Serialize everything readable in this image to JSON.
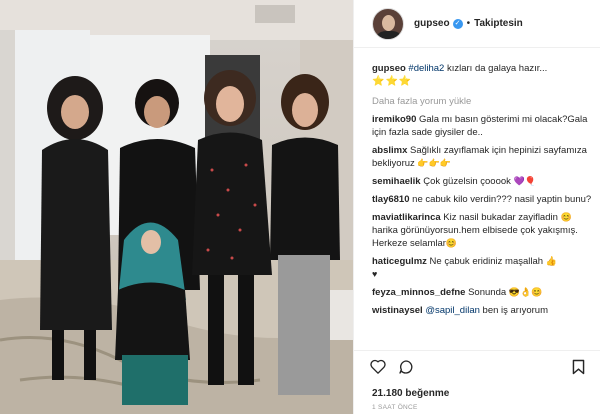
{
  "post": {
    "username": "gupseo",
    "verified_mark": "✓",
    "separator": "•",
    "follow_status": "Takiptesin"
  },
  "caption": {
    "username": "gupseo",
    "hashtag": "#deliha2",
    "text": " kızları da galaya hazır...",
    "stars": "⭐⭐⭐"
  },
  "load_more": "Daha fazla yorum yükle",
  "comments": [
    {
      "user": "iremiko90",
      "text": " Gala mı basın gösterimi mi olacak?Gala için fazla sade giysiler de.."
    },
    {
      "user": "abslimx",
      "text": " Sağlıklı zayıflamak için hepinizi sayfamıza bekliyoruz ",
      "emoji": "👉👉👉"
    },
    {
      "user": "semihaelik",
      "text": " Çok güzelsin çooook ",
      "emoji": "💜🎈"
    },
    {
      "user": "tlay6810",
      "text": " ne cabuk kilo verdin??? nasil yaptin bunu?"
    },
    {
      "user": "maviatlikarinca",
      "text": " Kiz nasil bukadar zayifladin ",
      "emoji": "😊",
      "text2": "harika görünüyorsun.hem elbisede çok yakışmış. Herkeze selamlar",
      "emoji2": "😊"
    },
    {
      "user": "haticegulmz",
      "text": " Ne çabuk eridiniz maşallah ",
      "emoji": "👍",
      "text2": "",
      "emoji2": "♥"
    },
    {
      "user": "feyza_minnos_defne",
      "text": " Sonunda ",
      "emoji": "😎👌😊"
    },
    {
      "user": "wistinaysel",
      "mention": "@sapil_dilan",
      "text": " ben iş arıyorum"
    }
  ],
  "likes": "21.180 beğenme",
  "time_ago": "1 SAAT ÖNCE",
  "icons": [
    "heart-icon",
    "comment-icon",
    "bookmark-icon"
  ],
  "colors": {
    "link": "#003569",
    "verified": "#3897f0",
    "muted": "#999999"
  }
}
